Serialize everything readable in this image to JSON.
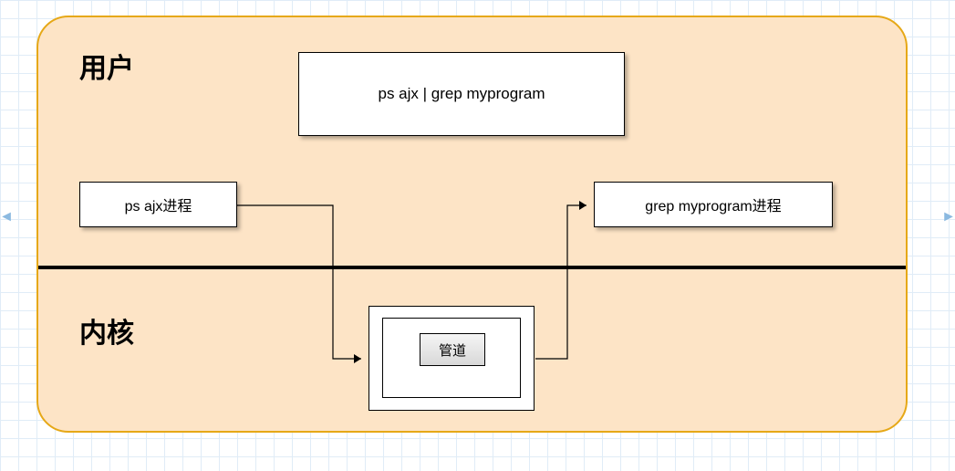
{
  "user_section_title": "用户",
  "kernel_section_title": "内核",
  "boxes": {
    "command": "ps  ajx | grep myprogram",
    "ps_process": "ps  ajx进程",
    "grep_process": "grep myprogram进程",
    "pipe_label": "管道"
  },
  "page_arrows": {
    "left": "◄",
    "right": "►"
  }
}
